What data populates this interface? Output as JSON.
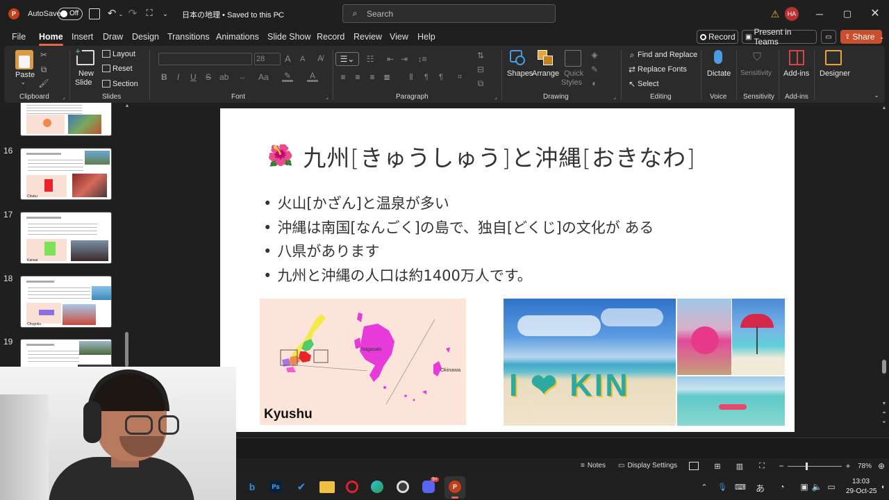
{
  "titlebar": {
    "autosave_label": "AutoSave",
    "toggle_label": "Off",
    "doc_title": "日本の地理 • Saved to this PC",
    "search_placeholder": "Search",
    "avatar_initials": "HA"
  },
  "menu": {
    "tabs": [
      "File",
      "Home",
      "Insert",
      "Draw",
      "Design",
      "Transitions",
      "Animations",
      "Slide Show",
      "Record",
      "Review",
      "View",
      "Help"
    ],
    "record_btn": "Record",
    "present_btn": "Present in Teams",
    "share_btn": "Share"
  },
  "ribbon": {
    "clipboard": {
      "paste": "Paste",
      "group": "Clipboard"
    },
    "slides": {
      "new_slide": "New",
      "new_slide2": "Slide",
      "layout": "Layout",
      "reset": "Reset",
      "section": "Section",
      "group": "Slides"
    },
    "font": {
      "size": "28",
      "group": "Font",
      "bold": "B",
      "italic": "I",
      "underline": "U",
      "strike": "S",
      "ab": "ab",
      "aa": "Aa",
      "grow": "A",
      "shrink": "A"
    },
    "paragraph": {
      "group": "Paragraph"
    },
    "drawing": {
      "shapes": "Shapes",
      "arrange": "Arrange",
      "quick1": "Quick",
      "quick2": "Styles",
      "group": "Drawing"
    },
    "editing": {
      "find": "Find and Replace",
      "replace": "Replace Fonts",
      "select": "Select",
      "group": "Editing"
    },
    "voice": {
      "dictate": "Dictate",
      "group": "Voice"
    },
    "sensitivity": {
      "label": "Sensitivity",
      "group": "Sensitivity"
    },
    "addins": {
      "label": "Add-ins",
      "group": "Add-ins"
    },
    "designer": {
      "label": "Designer"
    }
  },
  "thumbnails": [
    {
      "num": "16",
      "caption": "Chubu"
    },
    {
      "num": "17",
      "caption": "Kansai"
    },
    {
      "num": "18",
      "caption": "Chugoku"
    },
    {
      "num": "19",
      "caption": ""
    }
  ],
  "slide": {
    "title_icon": "🌺",
    "title": "九州[きゅうしゅう]と沖縄[おきなわ]",
    "bullets": [
      "火山[かざん]と温泉が多い",
      "沖縄は南国[なんごく]の島で、独自[どくじ]の文化が ある",
      "八県があります",
      "九州と沖縄の人口は約1400万人です。"
    ],
    "map_label": "Kyushu",
    "map_city1": "Nagasaki",
    "map_city2": "Okinawa",
    "photo_sign": "I ❤ KIN"
  },
  "status": {
    "notes": "Notes",
    "display": "Display Settings",
    "zoom": "78%"
  },
  "taskbar": {
    "time": "13:03",
    "date": "29-Oct-25",
    "ime": "あ",
    "badge": "9+"
  },
  "colors": {
    "accent": "#e4694c",
    "ribbon_bg": "#2b2b2b",
    "window_bg": "#1f1f1f"
  }
}
